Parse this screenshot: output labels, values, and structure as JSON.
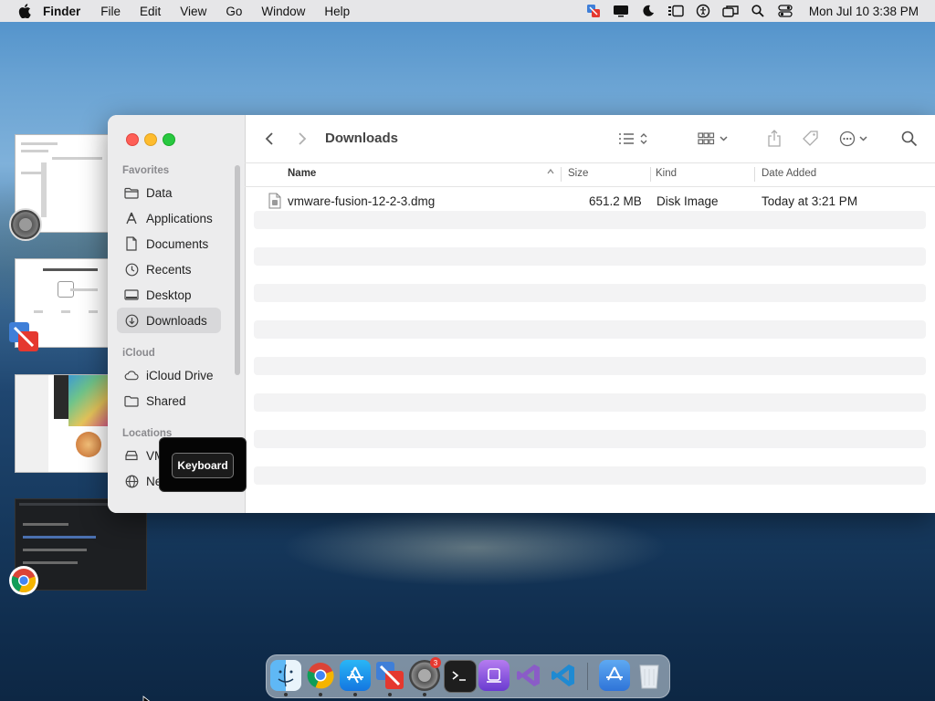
{
  "menubar": {
    "apple_icon": "apple-icon",
    "items": [
      "Finder",
      "File",
      "Edit",
      "View",
      "Go",
      "Window",
      "Help"
    ],
    "status_icons": [
      "vmware-fusion-icon",
      "display-icon",
      "moon-icon",
      "stage-manager-icon",
      "accessibility-icon",
      "screen-mirroring-icon",
      "spotlight-search-icon",
      "control-center-icon"
    ],
    "clock": "Mon Jul 10  3:38 PM"
  },
  "finder": {
    "title": "Downloads",
    "sidebar": {
      "sections": [
        {
          "header": "Favorites",
          "items": [
            {
              "label": "Data",
              "icon": "folder-icon"
            },
            {
              "label": "Applications",
              "icon": "applications-icon"
            },
            {
              "label": "Documents",
              "icon": "document-icon"
            },
            {
              "label": "Recents",
              "icon": "clock-icon"
            },
            {
              "label": "Desktop",
              "icon": "desktop-icon"
            },
            {
              "label": "Downloads",
              "icon": "download-icon",
              "selected": true
            }
          ]
        },
        {
          "header": "iCloud",
          "items": [
            {
              "label": "iCloud Drive",
              "icon": "cloud-icon"
            },
            {
              "label": "Shared",
              "icon": "shared-folder-icon"
            }
          ]
        },
        {
          "header": "Locations",
          "items": [
            {
              "label": "VM",
              "icon": "disk-icon"
            },
            {
              "label": "Ne",
              "icon": "network-icon"
            }
          ]
        }
      ]
    },
    "toolbar": {
      "back_icon": "chevron-left-icon",
      "forward_icon": "chevron-right-icon",
      "view_icon": "list-view-icon",
      "group_icon": "grid-group-icon",
      "share_icon": "share-icon",
      "tag_icon": "tag-icon",
      "more_icon": "ellipsis-circle-icon",
      "search_icon": "search-icon"
    },
    "columns": [
      "Name",
      "Size",
      "Kind",
      "Date Added"
    ],
    "files": [
      {
        "name": "vmware-fusion-12-2-3.dmg",
        "size": "651.2 MB",
        "kind": "Disk Image",
        "date_added": "Today at 3:21 PM"
      }
    ]
  },
  "tooltip": {
    "label": "Keyboard"
  },
  "dock": {
    "apps": [
      "finder-icon",
      "chrome-icon",
      "app-store-icon",
      "vmware-fusion-icon",
      "system-settings-icon",
      "terminal-icon",
      "podcasts-app-icon",
      "visual-studio-icon",
      "vscode-icon",
      "app-store-downloads-icon",
      "trash-icon"
    ],
    "badge": "3"
  },
  "colors": {
    "selected_sidebar": "#d8d8da",
    "close": "#fe5f57",
    "minimize": "#febc2e",
    "zoom": "#28c840"
  }
}
